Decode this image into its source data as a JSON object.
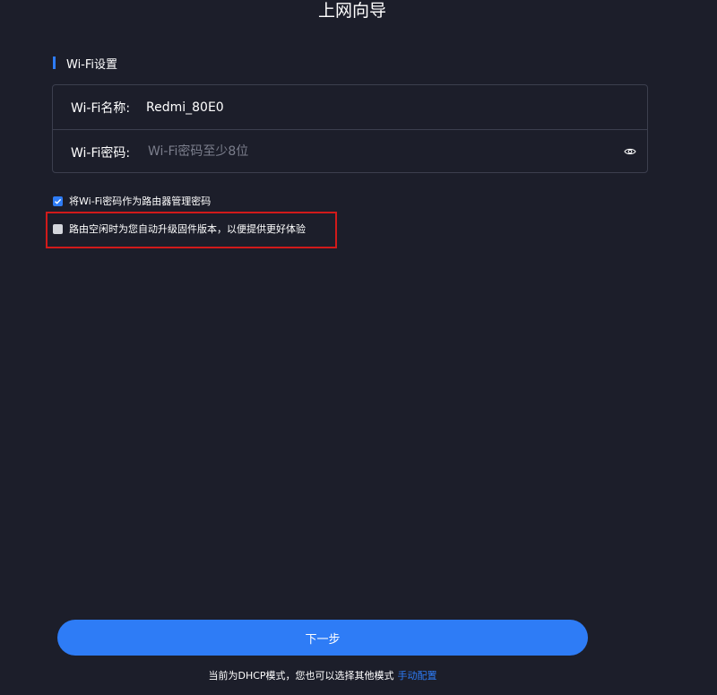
{
  "page": {
    "title": "上网向导"
  },
  "wifi_section": {
    "title": "Wi-Fi设置",
    "name_label": "Wi-Fi名称:",
    "name_value": "Redmi_80E0",
    "password_label": "Wi-Fi密码:",
    "password_placeholder": "Wi-Fi密码至少8位",
    "password_value": ""
  },
  "options": {
    "use_as_admin_password": {
      "label": "将Wi-Fi密码作为路由器管理密码",
      "checked": true
    },
    "auto_upgrade": {
      "label": "路由空闲时为您自动升级固件版本，以便提供更好体验",
      "checked": false
    }
  },
  "actions": {
    "next_label": "下一步"
  },
  "footer": {
    "text": "当前为DHCP模式，您也可以选择其他模式",
    "link_label": "手动配置"
  },
  "colors": {
    "background": "#1c1e2a",
    "accent": "#2e7cf6",
    "border": "#3c3f4e",
    "highlight": "#d11a1a"
  }
}
